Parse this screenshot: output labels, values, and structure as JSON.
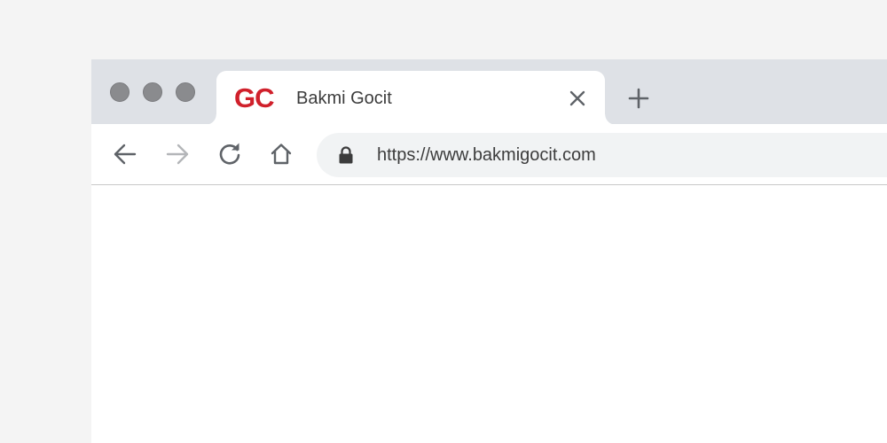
{
  "window": {
    "controls": [
      "close",
      "minimize",
      "maximize"
    ]
  },
  "tab": {
    "favicon_text": "GC",
    "title": "Bakmi Gocit",
    "close_icon": "close-icon"
  },
  "tabstrip": {
    "new_tab_icon": "plus-icon"
  },
  "toolbar": {
    "back_icon": "arrow-left-icon",
    "forward_icon": "arrow-right-icon",
    "reload_icon": "reload-icon",
    "home_icon": "home-icon"
  },
  "omnibox": {
    "lock_icon": "lock-icon",
    "url": "https://www.bakmigocit.com"
  },
  "colors": {
    "tabstrip_bg": "#dee1e6",
    "tab_bg": "#ffffff",
    "favicon": "#d0202b",
    "omnibox_bg": "#f1f3f4",
    "icon": "#5f6368",
    "icon_disabled": "#b4b6b9",
    "window_dot": "#8a8b8e"
  }
}
